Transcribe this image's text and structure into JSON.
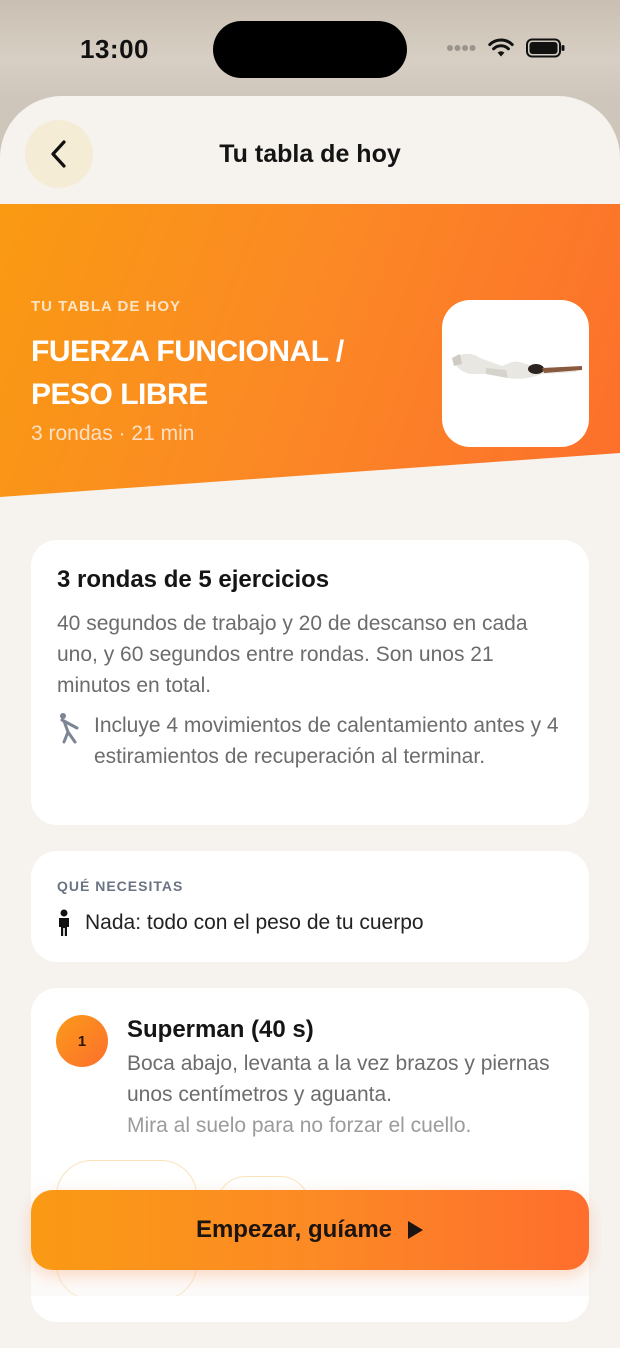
{
  "status_bar": {
    "time": "13:00"
  },
  "nav": {
    "title": "Tu tabla de hoy"
  },
  "hero": {
    "kicker": "TU TABLA DE HOY",
    "title": "FUERZA FUNCIONAL / PESO LIBRE",
    "meta": "3 rondas · 21 min"
  },
  "summary": {
    "title": "3 rondas de 5 ejercicios",
    "description": "40 segundos de trabajo y 20 de descanso en cada uno, y 60 segundos entre rondas. Son unos 21 minutos en total.",
    "note": "Incluye 4 movimientos de calentamiento antes y 4 estiramientos de recuperación al terminar."
  },
  "needs": {
    "label": "QUÉ NECESITAS",
    "text": "Nada: todo con el peso de tu cuerpo"
  },
  "exercise": {
    "number": "1",
    "title": "Superman (40 s)",
    "description": "Boca abajo, levanta a la vez brazos y piernas unos centímetros y aguanta.",
    "tip": "Mira al suelo para no forzar el cuello."
  },
  "cta": {
    "label": "Empezar, guíame"
  },
  "colors": {
    "accent_start": "#fa9a12",
    "accent_end": "#fd6f2c",
    "card_bg": "#ffffff",
    "sheet_bg": "#f6f3ef"
  },
  "icons": {
    "back": "chevron-left-icon",
    "stretch": "stretching-person-icon",
    "person": "person-icon",
    "play": "play-icon"
  }
}
